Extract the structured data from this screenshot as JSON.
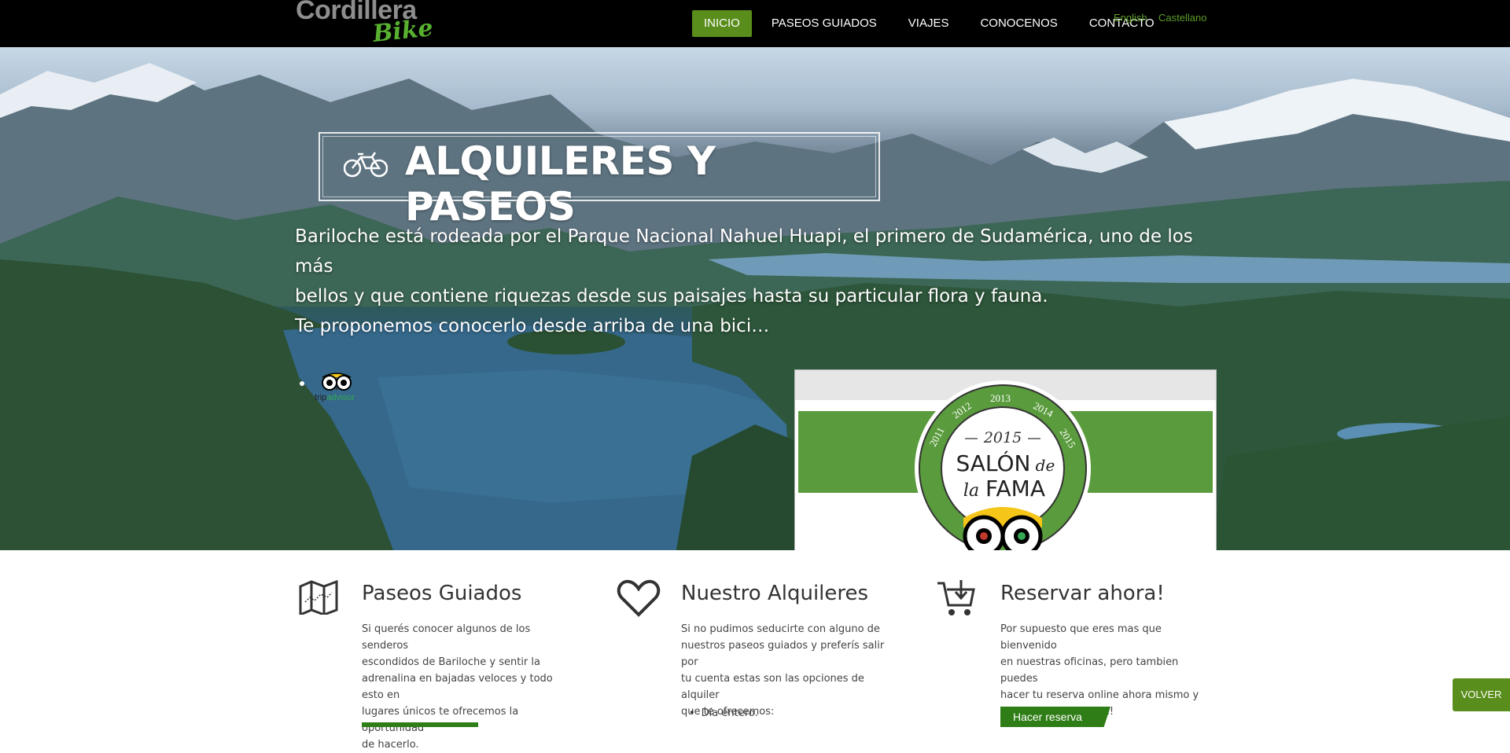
{
  "header": {
    "logo_main": "Cordillera",
    "logo_sub": "Bike",
    "nav": [
      {
        "label": "INICIO",
        "active": true
      },
      {
        "label": "PASEOS GUIADOS",
        "active": false
      },
      {
        "label": "VIAJES",
        "active": false
      },
      {
        "label": "CONOCENOS",
        "active": false
      },
      {
        "label": "CONTACTO",
        "active": false
      }
    ],
    "languages": [
      "English",
      "Castellano"
    ]
  },
  "hero": {
    "title": "ALQUILERES Y PASEOS",
    "intro": [
      "Bariloche está rodeada por el Parque Nacional Nahuel Huapi, el primero de Sudamérica, uno de los más",
      "bellos y que contiene riquezas desde sus paisajes hasta su particular flora y fauna.",
      "Te proponemos conocerlo desde arriba de una bici…"
    ],
    "tripadvisor_small": {
      "part1": "trip",
      "part2": "advisor"
    },
    "award": {
      "years": [
        "2011",
        "2012",
        "2013",
        "2014",
        "2015"
      ],
      "year_main": "2015",
      "line1": "SALÓN",
      "de": "de",
      "la": "la",
      "fama": "FAMA",
      "brand": "tripadvisor"
    }
  },
  "features": [
    {
      "icon": "map-icon",
      "title": "Paseos Guiados",
      "text": [
        "Si querés conocer algunos de los senderos",
        "escondidos de Bariloche y sentir la",
        "adrenalina en bajadas veloces y todo esto en",
        "lugares únicos te ofrecemos la oportunidad",
        "de hacerlo."
      ]
    },
    {
      "icon": "heart-icon",
      "title": "Nuestro Alquileres",
      "text": [
        "Si no pudimos seducirte con alguno de",
        "nuestros paseos guiados y preferís salir por",
        "tu cuenta estas son las opciones de alquiler",
        "que te ofrecemos:"
      ],
      "list": [
        "Día entero."
      ]
    },
    {
      "icon": "cart-icon",
      "title": "Reservar ahora!",
      "text": [
        "Por supuesto que eres mas que bienvenido",
        "en nuestras oficinas, pero tambien puedes",
        "hacer tu reserva online ahora mismo y",
        "garantizar ya tu viaje!"
      ],
      "button": "Hacer reserva"
    }
  ],
  "volver_button": "VOLVER"
}
